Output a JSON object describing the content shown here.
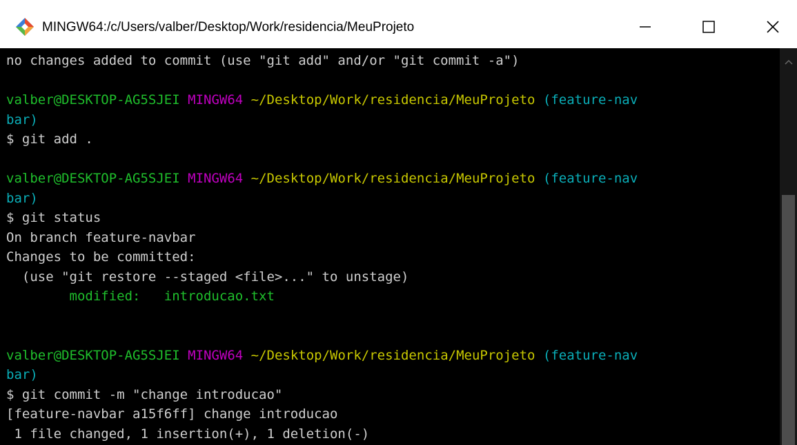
{
  "window": {
    "title": "MINGW64:/c/Users/valber/Desktop/Work/residencia/MeuProjeto",
    "icon": "git-bash-icon",
    "controls": [
      "minimize-icon",
      "maximize-icon",
      "close-icon"
    ]
  },
  "terminal": {
    "lines": [
      {
        "segments": [
          {
            "text": "no changes added to commit (use \"git add\" and/or \"git commit -a\")",
            "color": "white"
          }
        ]
      },
      {
        "segments": []
      },
      {
        "segments": [
          {
            "text": "valber@DESKTOP-AG5SJEI",
            "color": "green"
          },
          {
            "text": " ",
            "color": "white"
          },
          {
            "text": "MINGW64",
            "color": "magenta"
          },
          {
            "text": " ",
            "color": "white"
          },
          {
            "text": "~/Desktop/Work/residencia/MeuProjeto",
            "color": "yellow"
          },
          {
            "text": " ",
            "color": "white"
          },
          {
            "text": "(feature-nav",
            "color": "cyan"
          }
        ]
      },
      {
        "segments": [
          {
            "text": "bar)",
            "color": "cyan"
          }
        ]
      },
      {
        "segments": [
          {
            "text": "$ git add .",
            "color": "white"
          }
        ]
      },
      {
        "segments": []
      },
      {
        "segments": [
          {
            "text": "valber@DESKTOP-AG5SJEI",
            "color": "green"
          },
          {
            "text": " ",
            "color": "white"
          },
          {
            "text": "MINGW64",
            "color": "magenta"
          },
          {
            "text": " ",
            "color": "white"
          },
          {
            "text": "~/Desktop/Work/residencia/MeuProjeto",
            "color": "yellow"
          },
          {
            "text": " ",
            "color": "white"
          },
          {
            "text": "(feature-nav",
            "color": "cyan"
          }
        ]
      },
      {
        "segments": [
          {
            "text": "bar)",
            "color": "cyan"
          }
        ]
      },
      {
        "segments": [
          {
            "text": "$ git status",
            "color": "white"
          }
        ]
      },
      {
        "segments": [
          {
            "text": "On branch feature-navbar",
            "color": "white"
          }
        ]
      },
      {
        "segments": [
          {
            "text": "Changes to be committed:",
            "color": "white"
          }
        ]
      },
      {
        "segments": [
          {
            "text": "  (use \"git restore --staged <file>...\" to unstage)",
            "color": "white"
          }
        ]
      },
      {
        "segments": [
          {
            "text": "        modified:   introducao.txt",
            "color": "green"
          }
        ]
      },
      {
        "segments": []
      },
      {
        "segments": []
      },
      {
        "segments": [
          {
            "text": "valber@DESKTOP-AG5SJEI",
            "color": "green"
          },
          {
            "text": " ",
            "color": "white"
          },
          {
            "text": "MINGW64",
            "color": "magenta"
          },
          {
            "text": " ",
            "color": "white"
          },
          {
            "text": "~/Desktop/Work/residencia/MeuProjeto",
            "color": "yellow"
          },
          {
            "text": " ",
            "color": "white"
          },
          {
            "text": "(feature-nav",
            "color": "cyan"
          }
        ]
      },
      {
        "segments": [
          {
            "text": "bar)",
            "color": "cyan"
          }
        ]
      },
      {
        "segments": [
          {
            "text": "$ git commit -m \"change introducao\"",
            "color": "white"
          }
        ]
      },
      {
        "segments": [
          {
            "text": "[feature-navbar a15f6ff] change introducao",
            "color": "white"
          }
        ]
      },
      {
        "segments": [
          {
            "text": " 1 file changed, 1 insertion(+), 1 deletion(-)",
            "color": "white"
          }
        ]
      }
    ]
  },
  "scrollbar": {
    "up_icon": "chevron-up-icon"
  }
}
